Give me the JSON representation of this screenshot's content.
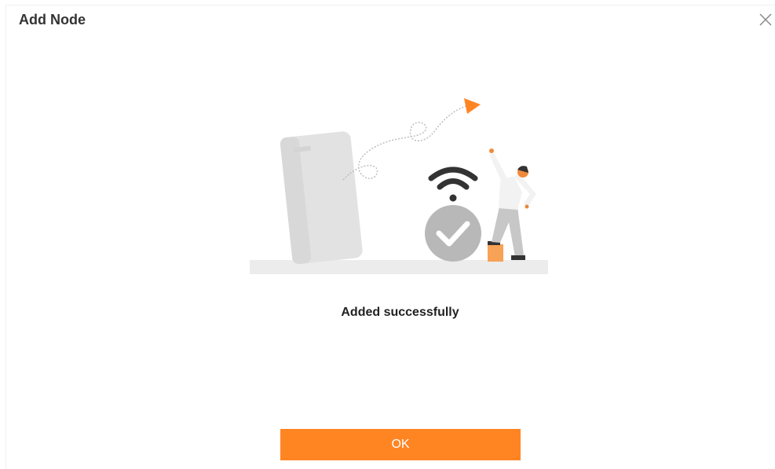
{
  "dialog": {
    "title": "Add Node",
    "close_icon": "close-icon",
    "message": "Added successfully",
    "ok_label": "OK"
  },
  "illustration": {
    "icons": [
      "phone-icon",
      "wifi-icon",
      "check-icon",
      "person-icon",
      "arrow-icon"
    ]
  },
  "colors": {
    "accent": "#ff8523",
    "illustration_gray": "#c8c8c8",
    "title_text": "#333333"
  }
}
